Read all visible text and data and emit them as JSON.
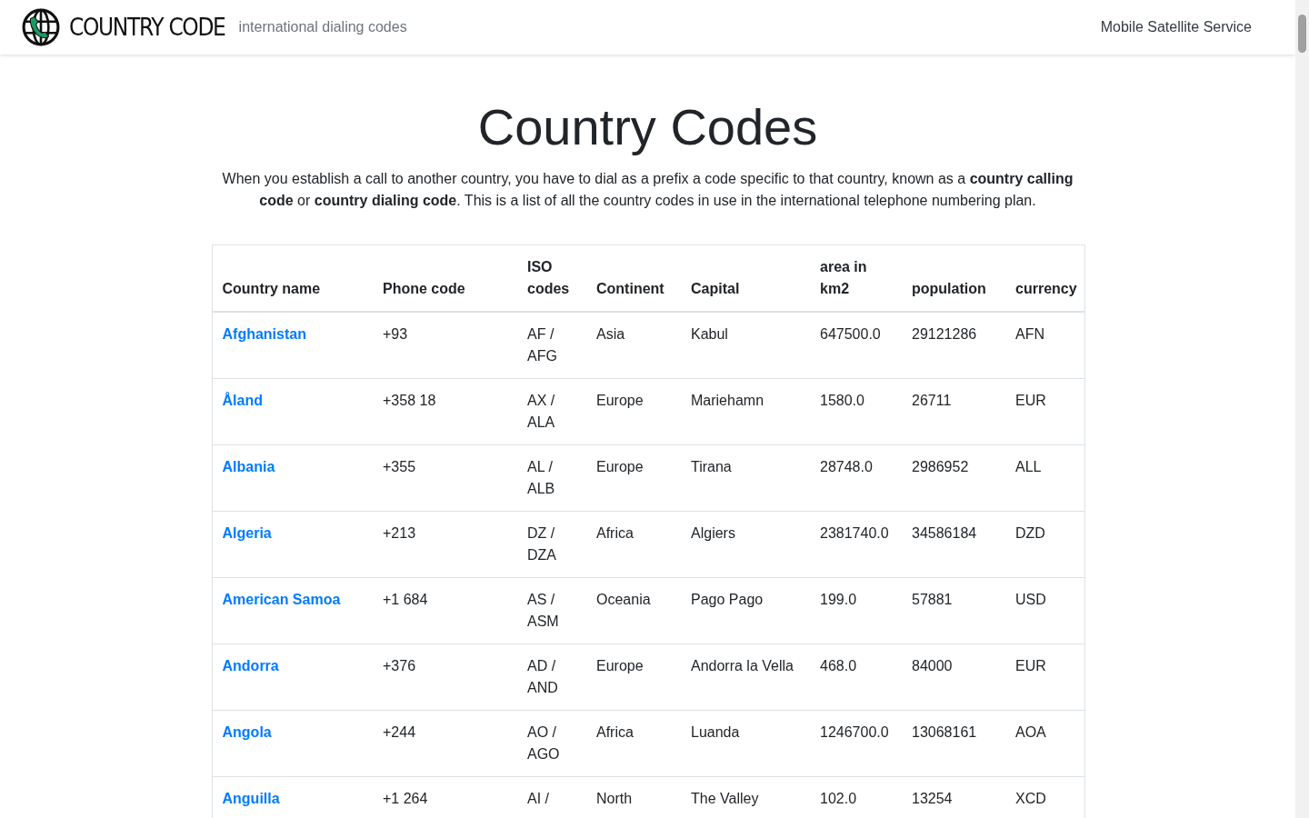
{
  "header": {
    "brand": "COUNTRY CODE",
    "tagline": "international dialing codes",
    "nav": [
      "Mobile Satellite Service"
    ]
  },
  "title": "Country Codes",
  "intro": "When you establish a call to another country, you have to dial as a prefix a code specific to that country, known as a **country calling code** or **country dialing code**. This is a list of all the country codes in use in the international telephone numbering plan.",
  "table": {
    "columns": [
      "Country name",
      "Phone code",
      "ISO codes",
      "Continent",
      "Capital",
      "area in km2",
      "population",
      "currency"
    ],
    "rows": [
      [
        "Afghanistan",
        "+93",
        "AF / AFG",
        "Asia",
        "Kabul",
        "647500.0",
        "29121286",
        "AFN"
      ],
      [
        "Åland",
        "+358 18",
        "AX / ALA",
        "Europe",
        "Mariehamn",
        "1580.0",
        "26711",
        "EUR"
      ],
      [
        "Albania",
        "+355",
        "AL / ALB",
        "Europe",
        "Tirana",
        "28748.0",
        "2986952",
        "ALL"
      ],
      [
        "Algeria",
        "+213",
        "DZ / DZA",
        "Africa",
        "Algiers",
        "2381740.0",
        "34586184",
        "DZD"
      ],
      [
        "American Samoa",
        "+1 684",
        "AS / ASM",
        "Oceania",
        "Pago Pago",
        "199.0",
        "57881",
        "USD"
      ],
      [
        "Andorra",
        "+376",
        "AD / AND",
        "Europe",
        "Andorra la Vella",
        "468.0",
        "84000",
        "EUR"
      ],
      [
        "Angola",
        "+244",
        "AO / AGO",
        "Africa",
        "Luanda",
        "1246700.0",
        "13068161",
        "AOA"
      ],
      [
        "Anguilla",
        "+1 264",
        "AI /",
        "North",
        "The Valley",
        "102.0",
        "13254",
        "XCD"
      ]
    ]
  }
}
